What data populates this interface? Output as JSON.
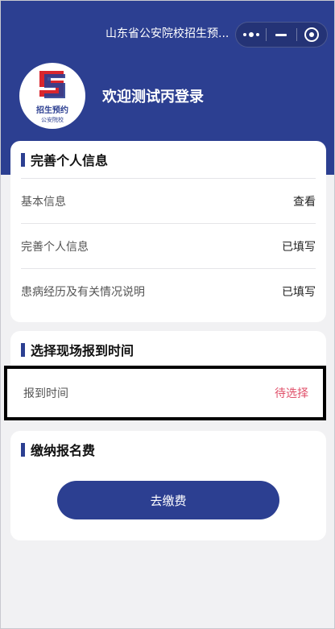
{
  "nav": {
    "title": "山东省公安院校招生预..."
  },
  "capsule": {
    "icons": [
      "more-icon",
      "minimize-icon",
      "close-target-icon"
    ]
  },
  "profile": {
    "logo_text_main": "招生预约",
    "logo_text_sub": "公安院校",
    "welcome": "欢迎测试丙登录"
  },
  "personal_info": {
    "title": "完善个人信息",
    "rows": [
      {
        "label": "基本信息",
        "value": "查看"
      },
      {
        "label": "完善个人信息",
        "value": "已填写"
      },
      {
        "label": "患病经历及有关情况说明",
        "value": "已填写"
      }
    ]
  },
  "report_time": {
    "title": "选择现场报到时间",
    "label": "报到时间",
    "value": "待选择"
  },
  "fee": {
    "title": "缴纳报名费",
    "button_label": "去缴费"
  },
  "colors": {
    "primary": "#2c3f91",
    "pending": "#e0506a",
    "logo_red": "#d9262e"
  }
}
